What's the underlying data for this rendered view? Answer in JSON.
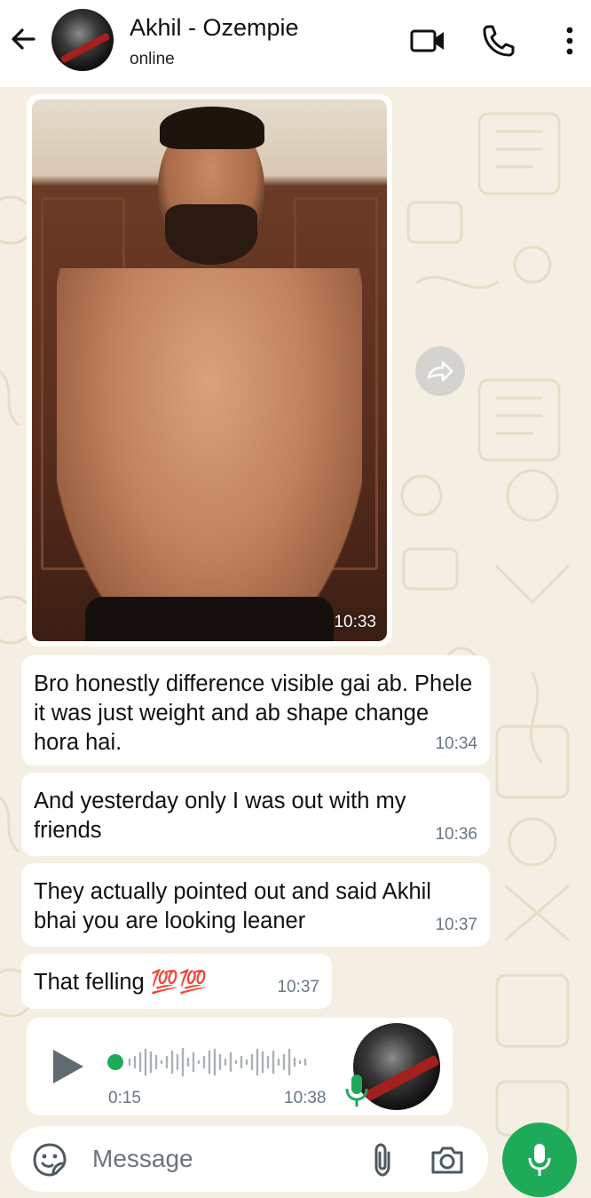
{
  "header": {
    "contact_name": "Akhil - Ozempie",
    "status": "online"
  },
  "messages": [
    {
      "type": "image",
      "time": "10:33"
    },
    {
      "type": "text",
      "text": "Bro honestly difference visible gai ab. Phele it was just weight and ab shape change hora hai.",
      "time": "10:34"
    },
    {
      "type": "text",
      "text": "And yesterday only I was out with my friends",
      "time": "10:36"
    },
    {
      "type": "text",
      "text": "They actually pointed out and said Akhil bhai you are looking leaner",
      "time": "10:37"
    },
    {
      "type": "text",
      "text": "That felling 💯💯",
      "time": "10:37"
    },
    {
      "type": "voice",
      "duration": "0:15",
      "time": "10:38"
    }
  ],
  "composer": {
    "placeholder": "Message"
  },
  "colors": {
    "header_bg": "#ffffff",
    "chat_bg": "#f5efe3",
    "bubble_bg": "#ffffff",
    "accent_green": "#1faa59",
    "timestamp": "#667781"
  }
}
